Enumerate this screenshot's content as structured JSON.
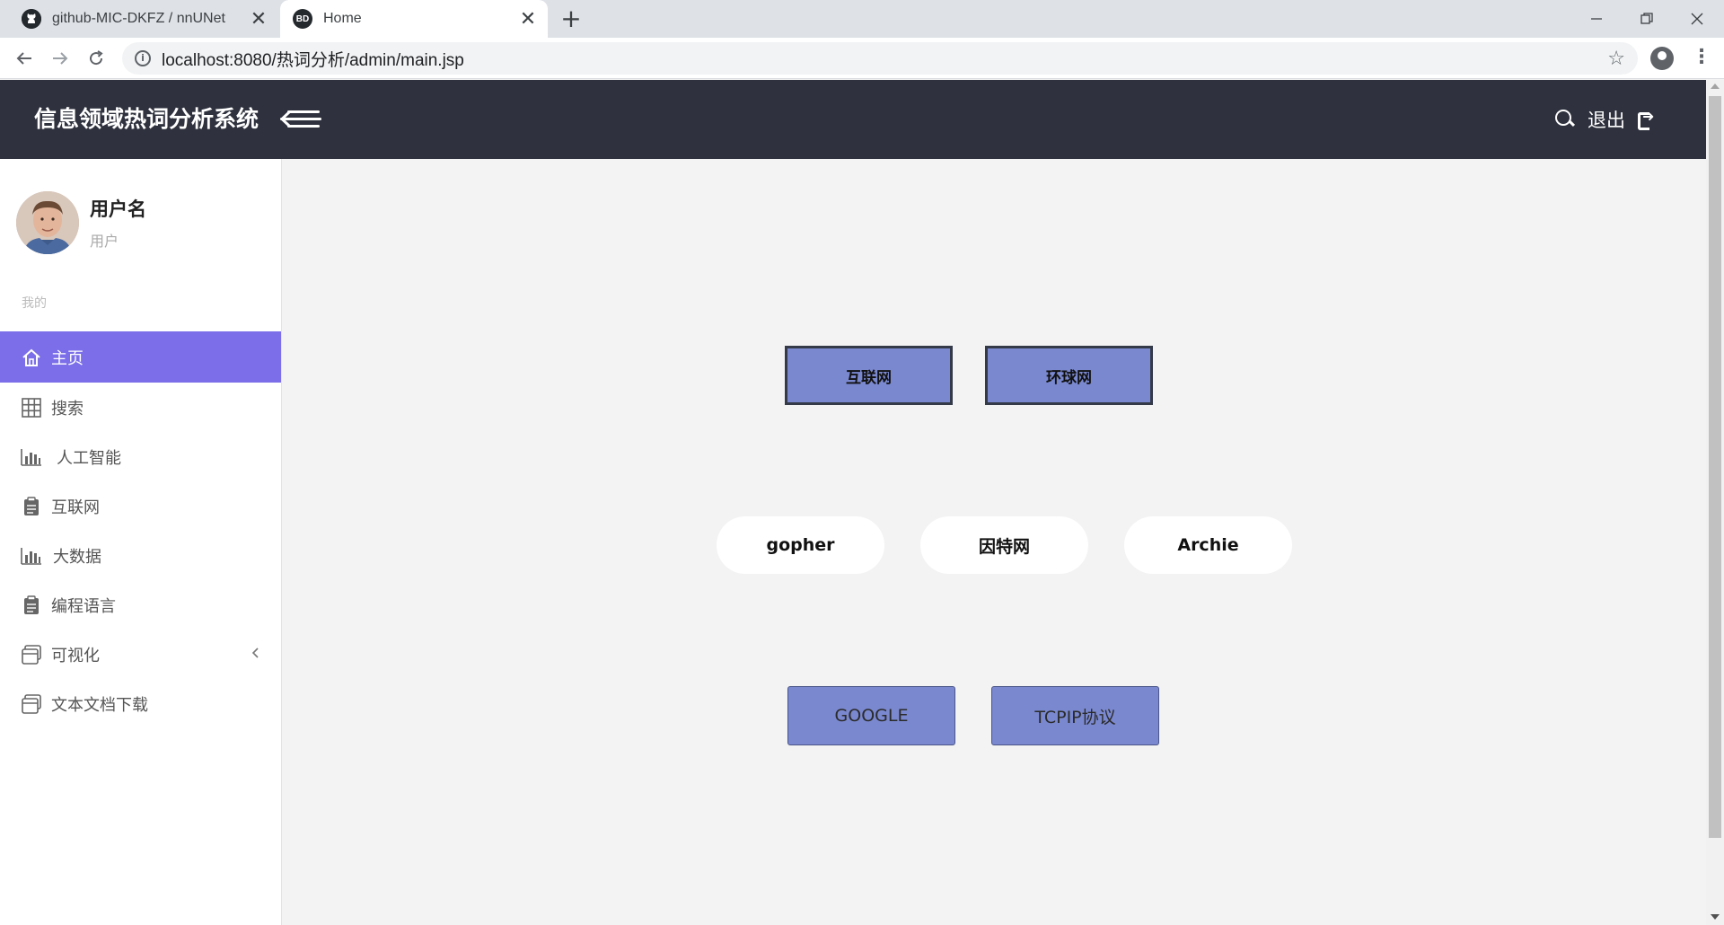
{
  "browser": {
    "tabs": [
      {
        "title": "github-MIC-DKFZ / nnUNet",
        "icon": "github-icon",
        "active": false
      },
      {
        "title": "Home",
        "icon": "site-favicon",
        "favicon_text": "BD",
        "active": true
      }
    ],
    "url": "localhost:8080/热词分析/admin/main.jsp",
    "new_tab_label": "+",
    "close_label": "✕"
  },
  "header": {
    "title": "信息领域热词分析系统",
    "logout_label": "退出",
    "background": "#2f323e"
  },
  "sidebar": {
    "user_name": "用户名",
    "user_role": "用户",
    "section_label": "我的",
    "items": [
      {
        "label": "主页",
        "icon": "home-icon",
        "active": true
      },
      {
        "label": "搜索",
        "icon": "grid-icon",
        "active": false
      },
      {
        "label": "人工智能",
        "icon": "bar-chart-icon",
        "active": false
      },
      {
        "label": "互联网",
        "icon": "clipboard-icon",
        "active": false
      },
      {
        "label": "大数据",
        "icon": "bar-chart-icon",
        "active": false
      },
      {
        "label": "编程语言",
        "icon": "clipboard-icon",
        "active": false
      },
      {
        "label": "可视化",
        "icon": "window-icon",
        "active": false,
        "has_submenu": true
      },
      {
        "label": "文本文档下载",
        "icon": "window-icon",
        "active": false
      }
    ],
    "active_color": "#7b6ee8"
  },
  "main": {
    "row1": [
      "互联网",
      "环球网"
    ],
    "row2": [
      "gopher",
      "因特网",
      "Archie"
    ],
    "row3": [
      "GOOGLE",
      "TCPIP协议"
    ],
    "button_color": "#7a88cf"
  }
}
